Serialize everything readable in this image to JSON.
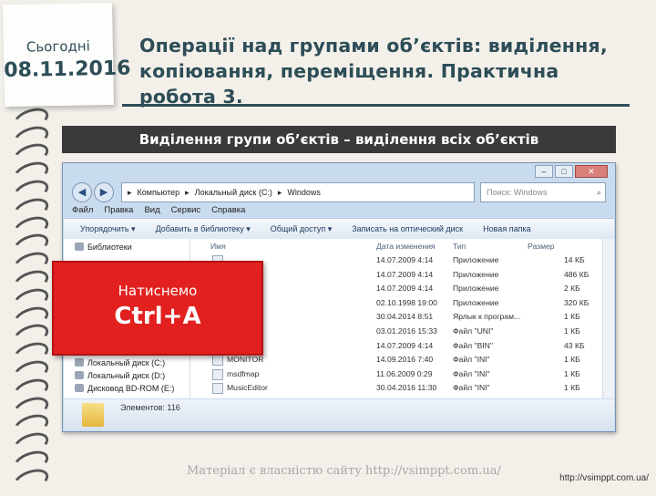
{
  "note": {
    "label": "Сьогодні",
    "date": "08.11.2016"
  },
  "title": "Операції над групами об’єктів: виділення, копіювання, переміщення. Практична робота 3.",
  "banner": "Виділення групи об’єктів – виділення всіх об’єктів",
  "explorer": {
    "address": [
      "Компьютер",
      "Локальный диск (C:)",
      "Windows"
    ],
    "search_placeholder": "Поиск: Windows",
    "menu": [
      "Файл",
      "Правка",
      "Вид",
      "Сервис",
      "Справка"
    ],
    "toolbar": [
      "Упорядочить ▾",
      "Добавить в библиотеку ▾",
      "Общий доступ ▾",
      "Записать на оптический диск",
      "Новая папка"
    ],
    "nav": [
      "Библиотеки",
      "Локальный диск (C:)",
      "Локальный диск (D:)",
      "Дисковод BD-ROM (E:)"
    ],
    "columns": [
      "Имя",
      "Дата изменения",
      "Тип",
      "Размер"
    ],
    "rows": [
      [
        "",
        "14.07.2009 4:14",
        "Приложение",
        "14 КБ"
      ],
      [
        "",
        "14.07.2009 4:14",
        "Приложение",
        "486 КБ"
      ],
      [
        "",
        "14.07.2009 4:14",
        "Приложение",
        "2 КБ"
      ],
      [
        "",
        "02.10.1998 19:00",
        "Приложение",
        "320 КБ"
      ],
      [
        "",
        "30.04.2014 8:51",
        "Ярлык к програм...",
        "1 КБ"
      ],
      [
        "",
        "03.01.2016 15:33",
        "Файл \"UNI\"",
        "1 КБ"
      ],
      [
        "",
        "14.07.2009 4:14",
        "Файл \"BIN\"",
        "43 КБ"
      ],
      [
        "MONITOR",
        "14.09.2016 7:40",
        "Файл \"INI\"",
        "1 КБ"
      ],
      [
        "msdfmap",
        "11.06.2009 0:29",
        "Файл \"INI\"",
        "1 КБ"
      ],
      [
        "MusicEditor",
        "30.04.2016 11:30",
        "Файл \"INI\"",
        "1 КБ"
      ]
    ],
    "status": "Элементов: 116"
  },
  "callout": {
    "line1": "Натиснемо",
    "line2": "Ctrl+A"
  },
  "watermark": "Матеріал є власністю сайту http://vsimppt.com.ua/",
  "footer_url": "http://vsimppt.com.ua/"
}
